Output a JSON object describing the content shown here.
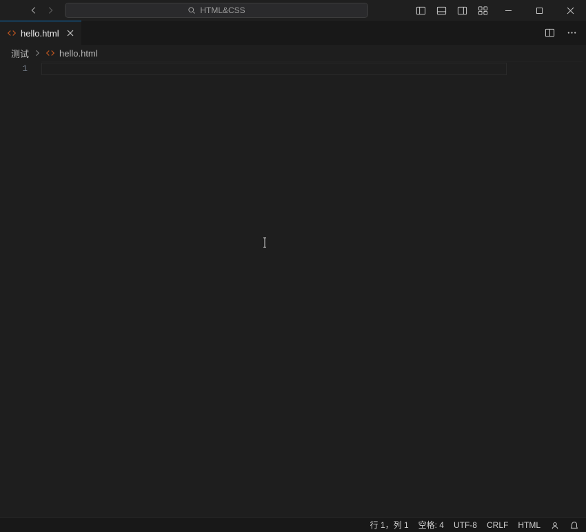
{
  "title_search": "HTML&CSS",
  "tab": {
    "filename": "hello.html"
  },
  "breadcrumb": {
    "folder": "测试",
    "file": "hello.html"
  },
  "editor": {
    "line_numbers": [
      "1"
    ]
  },
  "status": {
    "cursor": "行 1，列 1",
    "indent": "空格: 4",
    "encoding": "UTF-8",
    "eol": "CRLF",
    "language": "HTML"
  }
}
